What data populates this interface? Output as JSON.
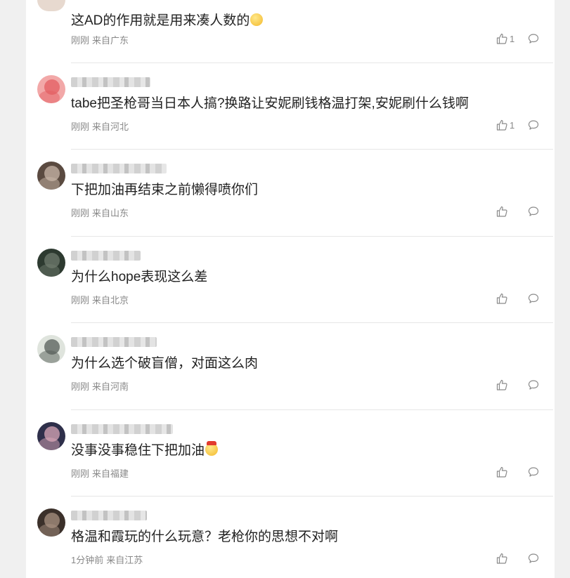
{
  "comments": [
    {
      "text": "这AD的作用就是用来凑人数的",
      "time": "刚刚",
      "location": "来自广东",
      "likes": "1",
      "emoji": "thinking-face",
      "avatar_colors": [
        "#e7d9cf",
        "#c8b3a4"
      ]
    },
    {
      "text": "tabe把圣枪哥当日本人搞?换路让安妮刷钱格温打架,安妮刷什么钱啊",
      "time": "刚刚",
      "location": "来自河北",
      "likes": "1",
      "avatar_colors": [
        "#f2a8a8",
        "#e35d62"
      ]
    },
    {
      "text": "下把加油再结束之前懒得喷你们",
      "time": "刚刚",
      "location": "来自山东",
      "likes": "",
      "avatar_colors": [
        "#5a4a40",
        "#c9b7a8"
      ]
    },
    {
      "text": "为什么hope表现这么差",
      "time": "刚刚",
      "location": "来自北京",
      "likes": "",
      "avatar_colors": [
        "#2d3a30",
        "#6f7b6e"
      ]
    },
    {
      "text": "为什么选个破盲僧，对面这么肉",
      "time": "刚刚",
      "location": "来自河南",
      "likes": "",
      "avatar_colors": [
        "#dfe4dd",
        "#555d58"
      ]
    },
    {
      "text": "没事没事稳住下把加油",
      "time": "刚刚",
      "location": "来自福建",
      "likes": "",
      "emoji": "cowboy-face",
      "avatar_colors": [
        "#2e2f4a",
        "#d9a8b8"
      ]
    },
    {
      "text": "格温和霞玩的什么玩意？老枪你的思想不对啊",
      "time": "1分钟前",
      "location": "来自江苏",
      "likes": "",
      "avatar_colors": [
        "#3b302a",
        "#a99282"
      ]
    }
  ]
}
